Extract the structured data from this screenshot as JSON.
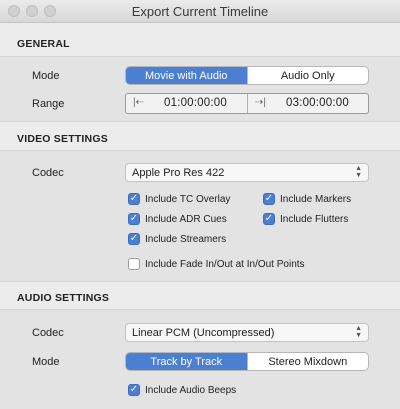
{
  "window": {
    "title": "Export Current Timeline"
  },
  "general": {
    "header": "GENERAL",
    "mode_label": "Mode",
    "mode_options": [
      "Movie with Audio",
      "Audio Only"
    ],
    "mode_selected": "Movie with Audio",
    "range_label": "Range",
    "range_in": "01:00:00:00",
    "range_out": "03:00:00:00",
    "in_icon": "mark-in-icon",
    "out_icon": "mark-out-icon"
  },
  "video": {
    "header": "VIDEO SETTINGS",
    "codec_label": "Codec",
    "codec_value": "Apple Pro Res 422",
    "checkboxes": [
      {
        "label": "Include TC Overlay",
        "checked": true
      },
      {
        "label": "Include Markers",
        "checked": true
      },
      {
        "label": "Include ADR Cues",
        "checked": true
      },
      {
        "label": "Include Flutters",
        "checked": true
      },
      {
        "label": "Include Streamers",
        "checked": true
      },
      {
        "label": "Include Fade In/Out at In/Out Points",
        "checked": false
      }
    ]
  },
  "audio": {
    "header": "AUDIO SETTINGS",
    "codec_label": "Codec",
    "codec_value": "Linear PCM (Uncompressed)",
    "mode_label": "Mode",
    "mode_options": [
      "Track by Track",
      "Stereo Mixdown"
    ],
    "mode_selected": "Track by Track",
    "checkboxes": [
      {
        "label": "Include Audio Beeps",
        "checked": true
      }
    ]
  },
  "colors": {
    "accent": "#4a7fd1",
    "panel": "#e3e3e3",
    "background": "#ececec"
  }
}
